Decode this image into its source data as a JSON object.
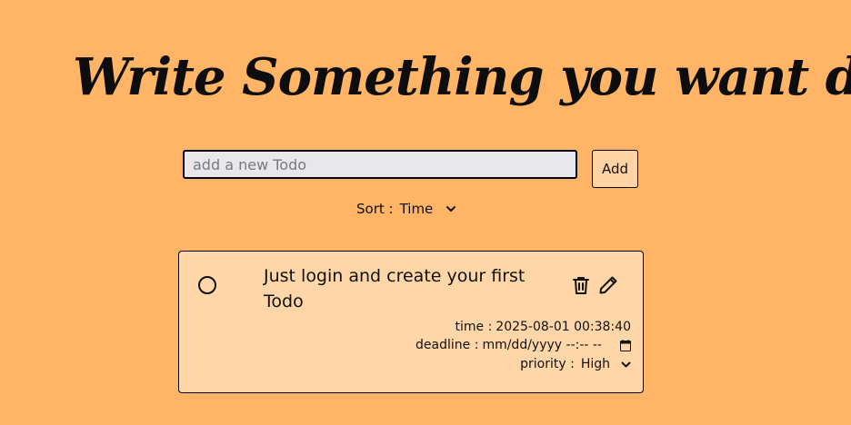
{
  "page": {
    "title": "Write Something you want do"
  },
  "form": {
    "input_placeholder": "add a new Todo",
    "input_value": "",
    "add_label": "Add"
  },
  "sort": {
    "label": "Sort :",
    "selected": "Time",
    "chevron_icon": "chevron-down-icon"
  },
  "todos": [
    {
      "text": "Just login and create your first Todo",
      "completed": false,
      "time_label": "time :",
      "time_value": "2025-08-01 00:38:40",
      "deadline_label": "deadline :",
      "deadline_value": "mm/dd/yyyy --:-- --",
      "priority_label": "priority :",
      "priority_value": "High",
      "icons": {
        "check": "circle-check-icon",
        "delete": "trash-icon",
        "edit": "pencil-icon",
        "calendar": "calendar-icon"
      }
    }
  ],
  "colors": {
    "background": "#ffb466",
    "card": "#ffd6a8",
    "input_background": "#e8e8ec",
    "button_background": "#ffd3a3",
    "text": "#111111"
  }
}
